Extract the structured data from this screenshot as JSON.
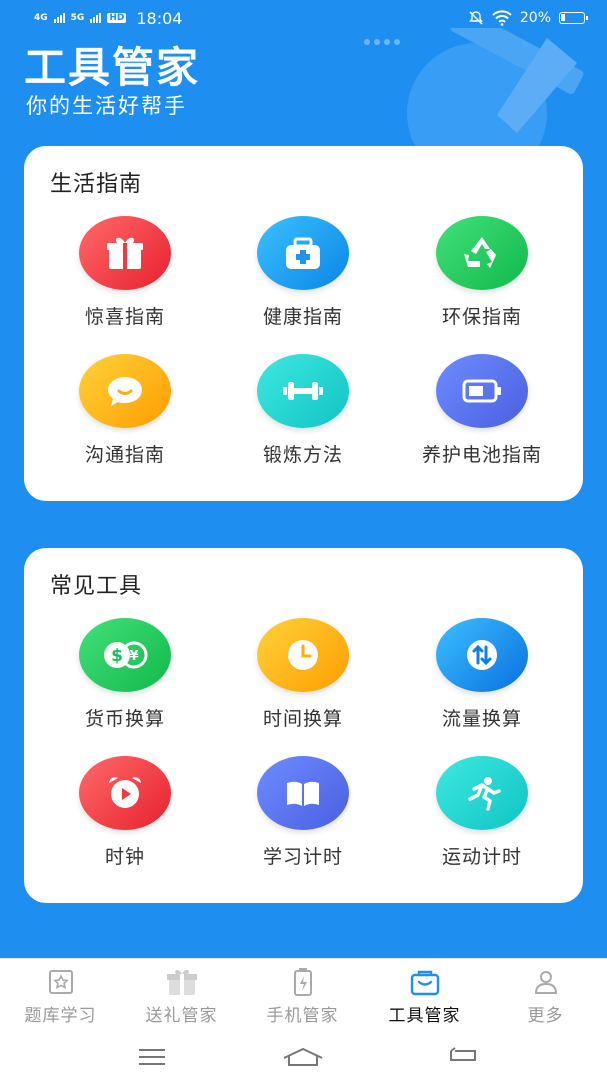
{
  "status_bar": {
    "network_1": "4G",
    "network_2": "5G",
    "hd": "HD",
    "time": "18:04",
    "battery": "20%"
  },
  "header": {
    "title": "工具管家",
    "subtitle": "你的生活好帮手"
  },
  "life_guide": {
    "title": "生活指南",
    "items": [
      {
        "label": "惊喜指南",
        "icon": "gift-icon",
        "color_from": "#ff6a6a",
        "color_to": "#e8202e"
      },
      {
        "label": "健康指南",
        "icon": "medical-kit-icon",
        "color_from": "#3cc0ff",
        "color_to": "#0a86e6"
      },
      {
        "label": "环保指南",
        "icon": "recycle-icon",
        "color_from": "#43e07a",
        "color_to": "#10b94a"
      },
      {
        "label": "沟通指南",
        "icon": "chat-bubble-icon",
        "color_from": "#ffd23a",
        "color_to": "#ff9d00"
      },
      {
        "label": "锻炼方法",
        "icon": "dumbbell-icon",
        "color_from": "#3ee8e0",
        "color_to": "#10c4c4"
      },
      {
        "label": "养护电池指南",
        "icon": "battery-icon",
        "color_from": "#6e8cff",
        "color_to": "#4a5fe0"
      }
    ]
  },
  "common_tools": {
    "title": "常见工具",
    "items": [
      {
        "label": "货币换算",
        "icon": "currency-icon",
        "color_from": "#43e07a",
        "color_to": "#10b94a"
      },
      {
        "label": "时间换算",
        "icon": "clock-icon",
        "color_from": "#ffd23a",
        "color_to": "#ff9d00"
      },
      {
        "label": "流量换算",
        "icon": "data-transfer-icon",
        "color_from": "#3cc0ff",
        "color_to": "#0a6fe0"
      },
      {
        "label": "时钟",
        "icon": "alarm-clock-icon",
        "color_from": "#ff6a6a",
        "color_to": "#e8202e"
      },
      {
        "label": "学习计时",
        "icon": "book-icon",
        "color_from": "#6e8cff",
        "color_to": "#4a5fe0"
      },
      {
        "label": "运动计时",
        "icon": "running-icon",
        "color_from": "#3ee8e0",
        "color_to": "#10c4c4"
      }
    ]
  },
  "tabs": [
    {
      "label": "题库学习",
      "icon": "quiz-icon",
      "active": false
    },
    {
      "label": "送礼管家",
      "icon": "gift-tab-icon",
      "active": false
    },
    {
      "label": "手机管家",
      "icon": "phone-battery-icon",
      "active": false
    },
    {
      "label": "工具管家",
      "icon": "toolbox-icon",
      "active": true
    },
    {
      "label": "更多",
      "icon": "user-icon",
      "active": false
    }
  ],
  "colors": {
    "background": "#1e8ff0",
    "card": "#ffffff",
    "active_tab": "#1e8ff0"
  }
}
